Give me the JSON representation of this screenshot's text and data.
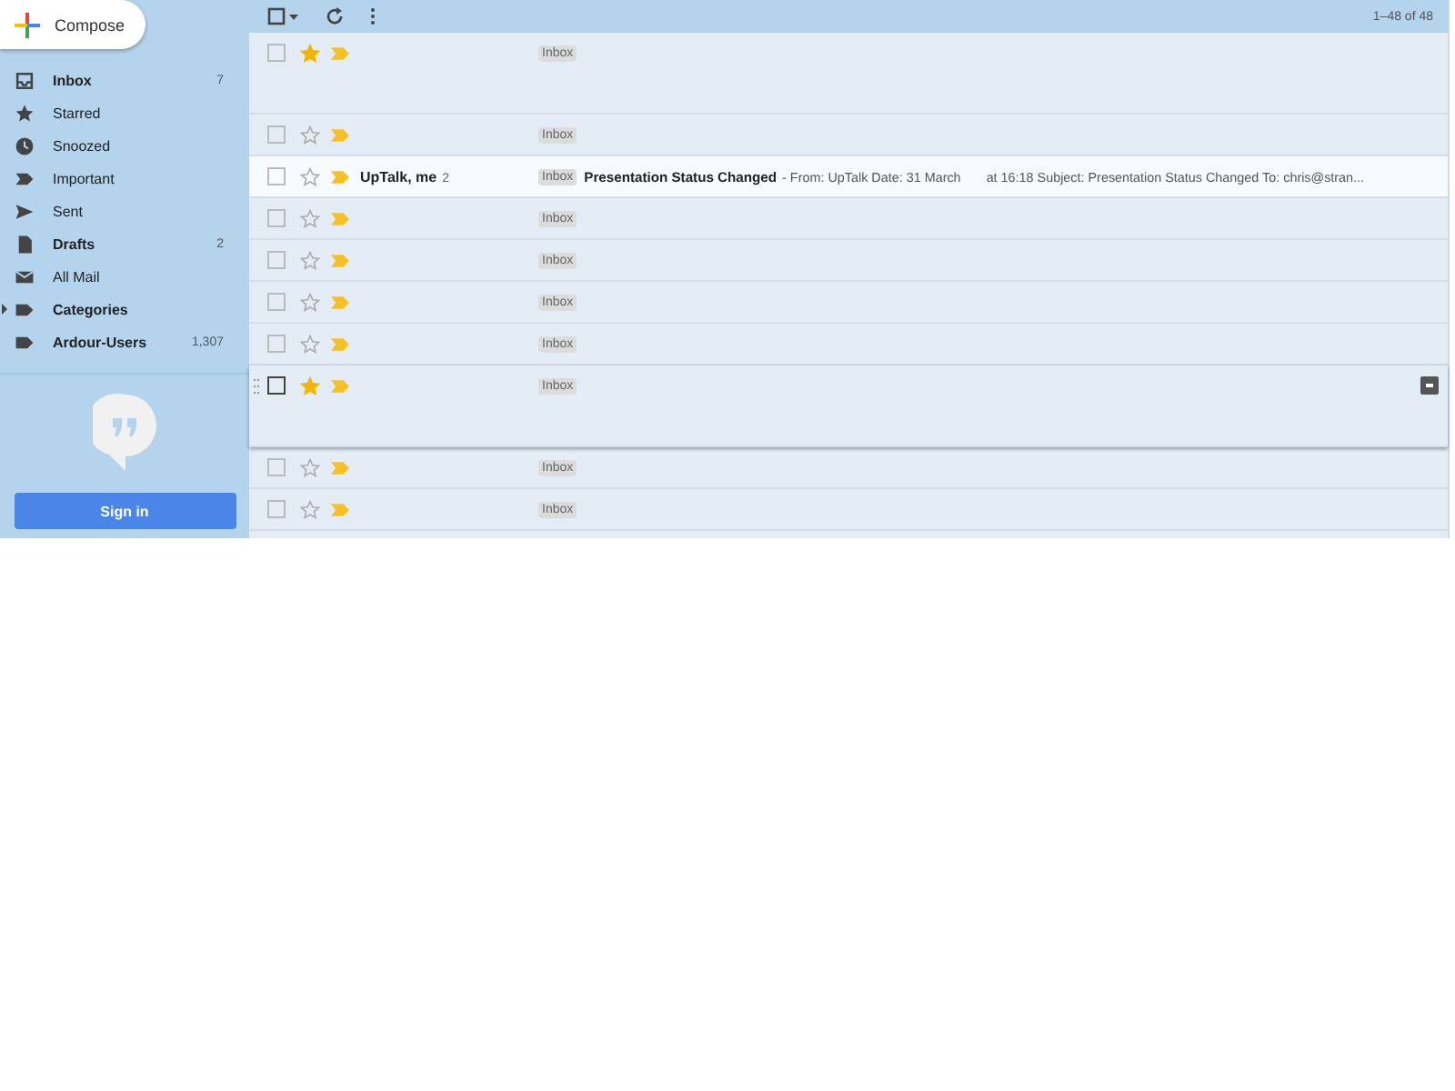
{
  "compose": {
    "label": "Compose"
  },
  "sidebar": {
    "items": [
      {
        "label": "Inbox",
        "kind": "inbox",
        "bold": true,
        "count": "7"
      },
      {
        "label": "Starred",
        "kind": "star",
        "bold": false
      },
      {
        "label": "Snoozed",
        "kind": "clock",
        "bold": false
      },
      {
        "label": "Important",
        "kind": "important",
        "bold": false
      },
      {
        "label": "Sent",
        "kind": "sent",
        "bold": false
      },
      {
        "label": "Drafts",
        "kind": "draft",
        "bold": true,
        "count": "2"
      },
      {
        "label": "All Mail",
        "kind": "mail",
        "bold": false
      },
      {
        "label": "Categories",
        "kind": "label",
        "bold": true,
        "expandable": true
      },
      {
        "label": "Ardour-Users",
        "kind": "label",
        "bold": true,
        "count": "1,307"
      }
    ],
    "sign_in": "Sign in"
  },
  "toolbar": {
    "range": "1–48 of 48"
  },
  "rows": [
    {
      "starred": true,
      "important": true,
      "unread": false,
      "expanded": true,
      "hovered": false,
      "label": "Inbox"
    },
    {
      "starred": false,
      "important": true,
      "unread": false,
      "expanded": false,
      "hovered": false,
      "label": "Inbox"
    },
    {
      "starred": false,
      "important": true,
      "unread": true,
      "expanded": false,
      "hovered": false,
      "sender": "UpTalk, me",
      "count": "2",
      "label": "Inbox",
      "subject": "Presentation Status Changed",
      "snippet": "- From: UpTalk Date: 31 March",
      "snippet_2": "at 16:18 Subject: Presentation Status Changed To: chris@stran..."
    },
    {
      "starred": false,
      "important": true,
      "unread": false,
      "expanded": false,
      "hovered": false,
      "label": "Inbox"
    },
    {
      "starred": false,
      "important": true,
      "unread": false,
      "expanded": false,
      "hovered": false,
      "label": "Inbox"
    },
    {
      "starred": false,
      "important": true,
      "unread": false,
      "expanded": false,
      "hovered": false,
      "label": "Inbox"
    },
    {
      "starred": false,
      "important": true,
      "unread": false,
      "expanded": false,
      "hovered": false,
      "label": "Inbox"
    },
    {
      "starred": true,
      "important": true,
      "unread": false,
      "expanded": true,
      "hovered": true,
      "label": "Inbox"
    },
    {
      "starred": false,
      "important": true,
      "unread": false,
      "expanded": false,
      "hovered": false,
      "label": "Inbox"
    },
    {
      "starred": false,
      "important": true,
      "unread": false,
      "expanded": false,
      "hovered": false,
      "label": "Inbox"
    }
  ]
}
